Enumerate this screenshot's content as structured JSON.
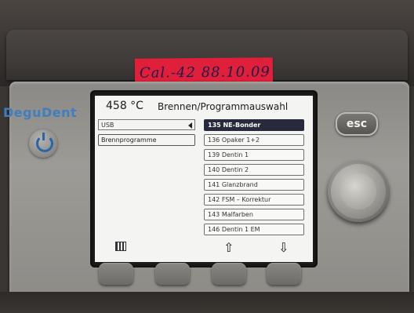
{
  "sticker": {
    "text": "Cal.-42 88.10.09"
  },
  "device": {
    "brand": "DeguDent",
    "esc_label": "esc"
  },
  "screen": {
    "temperature": "458 °C",
    "title": "Brennen/Programmauswahl",
    "source": "USB",
    "category": "Brennprogramme",
    "programs": [
      {
        "label": "135 NE-Bonder",
        "selected": true
      },
      {
        "label": "136 Opaker 1+2",
        "selected": false
      },
      {
        "label": "139 Dentin 1",
        "selected": false
      },
      {
        "label": "140 Dentin 2",
        "selected": false
      },
      {
        "label": "141 Glanzbrand",
        "selected": false
      },
      {
        "label": "142 FSM – Korrektur",
        "selected": false
      },
      {
        "label": "143 Malfarben",
        "selected": false
      },
      {
        "label": "146 Dentin 1 EM",
        "selected": false
      }
    ],
    "footer": {
      "up_arrow": "⇧",
      "down_arrow": "⇩"
    }
  },
  "icons": [
    "power-icon",
    "keypad-icon",
    "arrow-up-icon",
    "arrow-down-icon",
    "triangle-left-icon"
  ]
}
